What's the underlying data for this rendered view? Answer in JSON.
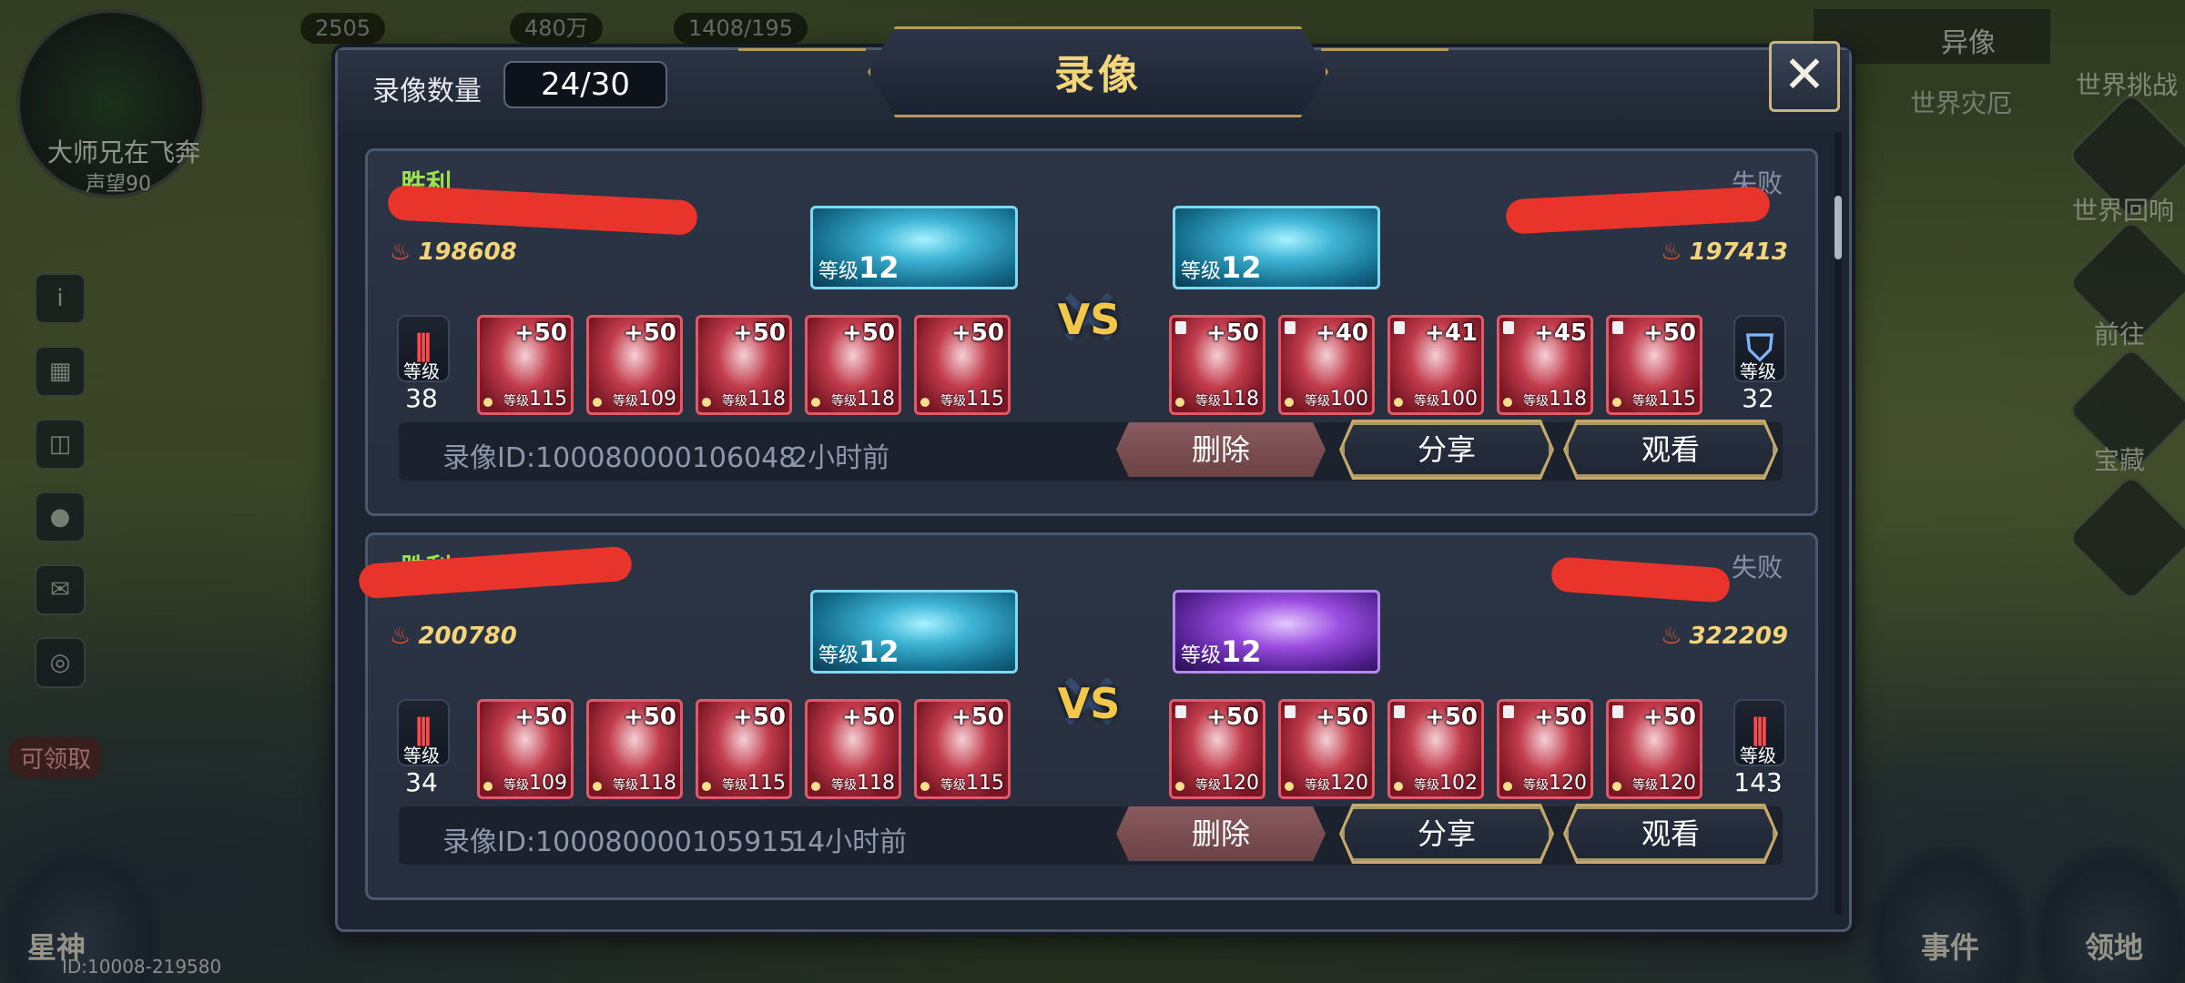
{
  "background": {
    "player_name": "大师兄在飞奔",
    "player_power": "声望90",
    "resources": [
      "2505",
      "480万",
      "1408/195"
    ],
    "world_button": "异像",
    "world_label": "世界灾厄",
    "right_menu": [
      "世界挑战",
      "世界回响",
      "前往",
      "宝藏"
    ],
    "corner_left": "星神",
    "corner_right_1": "事件",
    "corner_right_2": "领地",
    "redeem_label": "可领取",
    "uid": "ID:10008-219580"
  },
  "modal": {
    "count_label": "录像数量",
    "count_value": "24/30",
    "title": "录像",
    "close_label": "✕"
  },
  "records": [
    {
      "left_result": "胜利",
      "right_result": "失败",
      "left_power": "198608",
      "right_power": "197413",
      "left_boss_level": "12",
      "right_boss_level": "12",
      "boss_level_prefix": "等级",
      "vs_label": "VS",
      "left_pet_level": "38",
      "right_pet_level": "32",
      "left_heroes": [
        {
          "plus": "+50",
          "level": "115"
        },
        {
          "plus": "+50",
          "level": "109"
        },
        {
          "plus": "+50",
          "level": "118"
        },
        {
          "plus": "+50",
          "level": "118"
        },
        {
          "plus": "+50",
          "level": "115"
        }
      ],
      "right_heroes": [
        {
          "plus": "+50",
          "level": "118"
        },
        {
          "plus": "+40",
          "level": "100"
        },
        {
          "plus": "+41",
          "level": "100"
        },
        {
          "plus": "+45",
          "level": "118"
        },
        {
          "plus": "+50",
          "level": "115"
        }
      ],
      "record_id": "录像ID:100080000106048",
      "time_ago": "2小时前",
      "delete_label": "删除",
      "share_label": "分享",
      "watch_label": "观看"
    },
    {
      "left_result": "胜利",
      "right_result": "失败",
      "left_power": "200780",
      "right_power": "322209",
      "left_boss_level": "12",
      "right_boss_level": "12",
      "boss_level_prefix": "等级",
      "vs_label": "VS",
      "left_pet_level": "34",
      "right_pet_level": "143",
      "left_heroes": [
        {
          "plus": "+50",
          "level": "109"
        },
        {
          "plus": "+50",
          "level": "118"
        },
        {
          "plus": "+50",
          "level": "115"
        },
        {
          "plus": "+50",
          "level": "118"
        },
        {
          "plus": "+50",
          "level": "115"
        }
      ],
      "right_heroes": [
        {
          "plus": "+50",
          "level": "120"
        },
        {
          "plus": "+50",
          "level": "120"
        },
        {
          "plus": "+50",
          "level": "102"
        },
        {
          "plus": "+50",
          "level": "120"
        },
        {
          "plus": "+50",
          "level": "120"
        }
      ],
      "record_id": "录像ID:100080000105915",
      "time_ago": "14小时前",
      "delete_label": "删除",
      "share_label": "分享",
      "watch_label": "观看"
    }
  ],
  "hero_level_prefix": "等级",
  "pet_level_prefix": "等级"
}
